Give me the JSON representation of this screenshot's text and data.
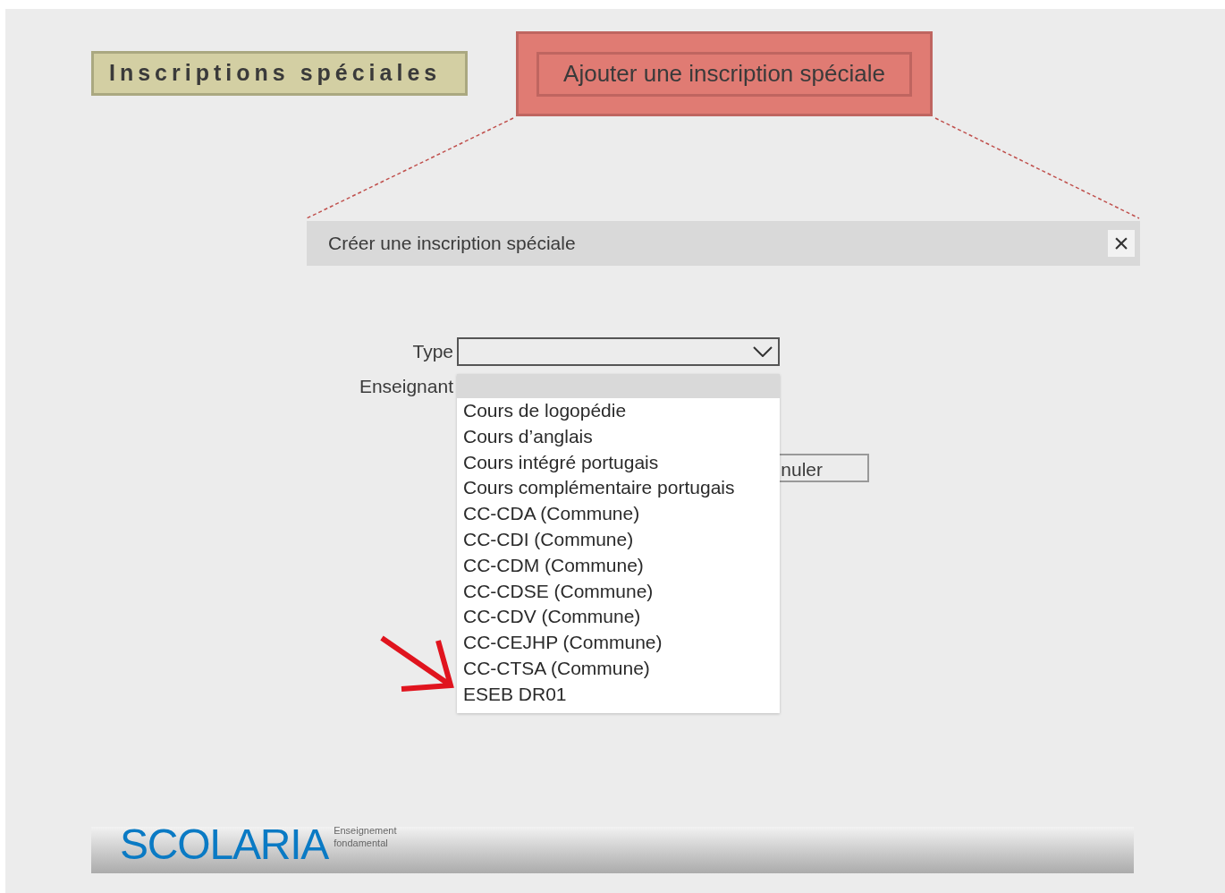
{
  "header": {
    "title": "Inscriptions spéciales",
    "add_button": "Ajouter une inscription spéciale"
  },
  "dialog": {
    "title": "Créer une inscription spéciale",
    "close": "×",
    "fields": [
      {
        "label": "Type"
      },
      {
        "label": "Enseignant"
      }
    ],
    "type_options": [
      "Cours de logopédie",
      "Cours d’anglais",
      "Cours intégré portugais",
      "Cours complémentaire portugais",
      "CC-CDA (Commune)",
      "CC-CDI (Commune)",
      "CC-CDM (Commune)",
      "CC-CDSE (Commune)",
      "CC-CDV (Commune)",
      "CC-CEJHP (Commune)",
      "CC-CTSA (Commune)",
      "ESEB DR01"
    ],
    "cancel_button": "nuler"
  },
  "footer": {
    "logo": "SCOLARIA",
    "tagline": [
      "Enseignement",
      "fondamental"
    ]
  }
}
